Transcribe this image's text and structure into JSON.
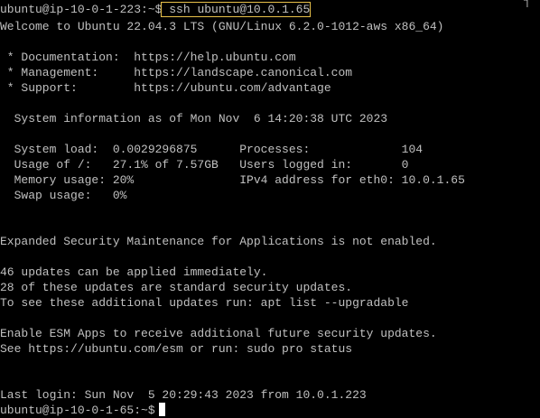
{
  "terminal": {
    "top_fragment": "┤",
    "ssh": {
      "prompt": "ubuntu@ip-10-0-1-223:~$",
      "command": "ssh ubuntu@10.0.1.65"
    },
    "welcome": "Welcome to Ubuntu 22.04.3 LTS (GNU/Linux 6.2.0-1012-aws x86_64)",
    "links": [
      " * Documentation:  https://help.ubuntu.com",
      " * Management:     https://landscape.canonical.com",
      " * Support:        https://ubuntu.com/advantage"
    ],
    "sysinfo_header": "  System information as of Mon Nov  6 14:20:38 UTC 2023",
    "sysinfo": [
      "  System load:  0.0029296875      Processes:             104",
      "  Usage of /:   27.1% of 7.57GB   Users logged in:       0",
      "  Memory usage: 20%               IPv4 address for eth0: 10.0.1.65",
      "  Swap usage:   0%"
    ],
    "esm_notice": "Expanded Security Maintenance for Applications is not enabled.",
    "updates": [
      "46 updates can be applied immediately.",
      "28 of these updates are standard security updates.",
      "To see these additional updates run: apt list --upgradable"
    ],
    "esm_apps": [
      "Enable ESM Apps to receive additional future security updates.",
      "See https://ubuntu.com/esm or run: sudo pro status"
    ],
    "last_login": "Last login: Sun Nov  5 20:29:43 2023 from 10.0.1.223",
    "final_prompt": "ubuntu@ip-10-0-1-65:~$"
  }
}
